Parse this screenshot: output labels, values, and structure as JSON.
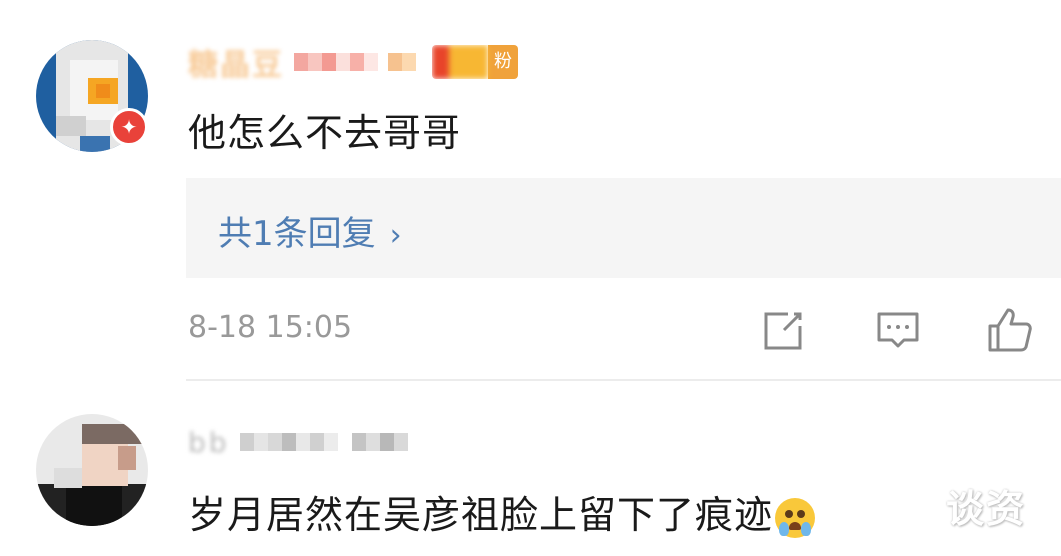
{
  "comments": [
    {
      "username": "糖晶豆",
      "fan_badge_label": "粉",
      "text": "他怎么不去哥哥",
      "replies_label": "共1条回复",
      "timestamp": "8-18 15:05"
    },
    {
      "username": "bb",
      "text": "岁月居然在吴彦祖脸上留下了痕迹"
    }
  ],
  "actions": [
    {
      "name": "share-icon",
      "label": "share"
    },
    {
      "name": "comment-icon",
      "label": "comment"
    },
    {
      "name": "like-icon",
      "label": "like"
    }
  ],
  "watermark": "谈资",
  "colors": {
    "link": "#4f7db3",
    "timestamp": "#999999",
    "reply_bg": "#f5f5f5",
    "username": "#f2a34a"
  }
}
